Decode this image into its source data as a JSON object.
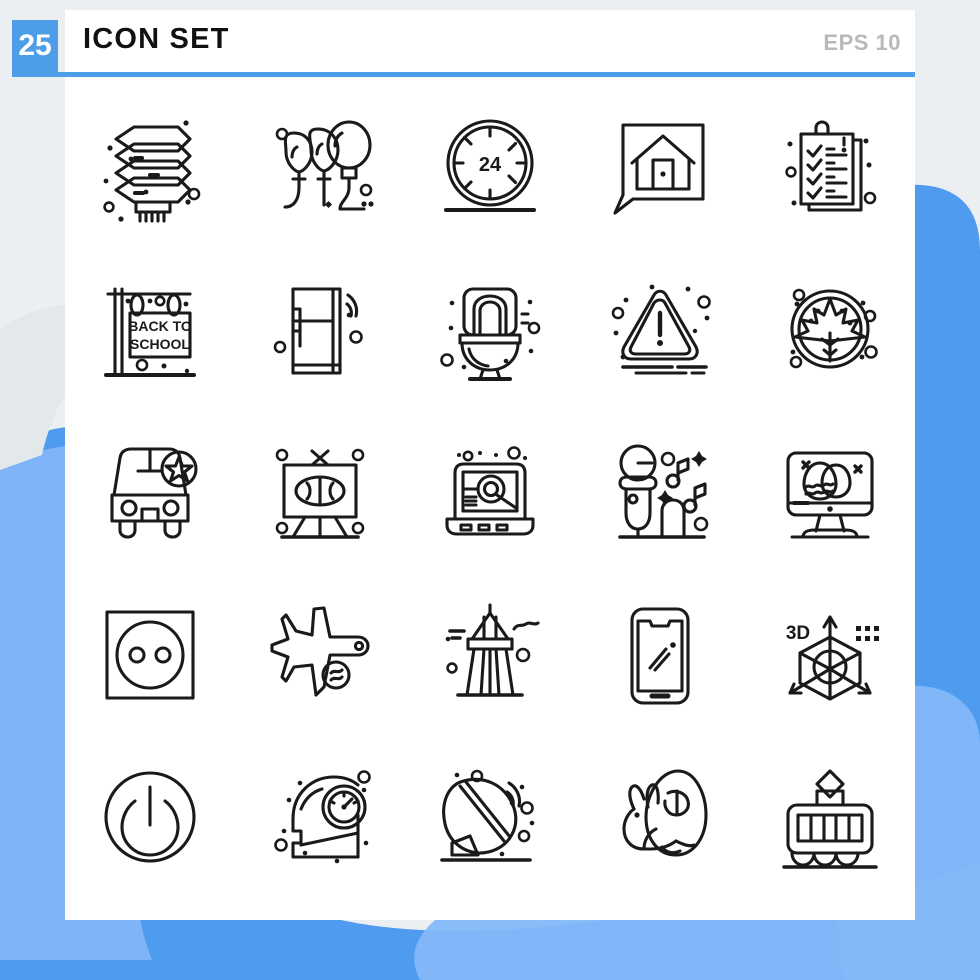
{
  "header": {
    "count_badge": "25",
    "title": "ICON SET",
    "format_label": "EPS 10",
    "accent_color": "#4d9de8",
    "title_color": "#111111",
    "format_color": "#b7b9bb"
  },
  "canvas": {
    "background_color": "#eceff1",
    "card_color": "#ffffff",
    "blob_color_dark": "#4f9bf0",
    "blob_color_light": "#84b8f8",
    "icon_stroke_color": "#1a1a1a"
  },
  "grid": {
    "rows": 5,
    "columns": 5,
    "total": 25
  },
  "icons": [
    {
      "index": 1,
      "name": "server-stack-icon",
      "label": "Server"
    },
    {
      "index": 2,
      "name": "balloons-icon",
      "label": "Balloons"
    },
    {
      "index": 3,
      "name": "clock-24-hours-icon",
      "label": "24 Hours",
      "text": "24"
    },
    {
      "index": 4,
      "name": "home-photo-icon",
      "label": "Home Photo"
    },
    {
      "index": 5,
      "name": "checklist-clipboard-icon",
      "label": "Checklist"
    },
    {
      "index": 6,
      "name": "back-to-school-sign-icon",
      "label": "Back To School",
      "text": [
        "BACK TO",
        "SCHOOL"
      ]
    },
    {
      "index": 7,
      "name": "smart-refrigerator-icon",
      "label": "Smart Fridge"
    },
    {
      "index": 8,
      "name": "toilet-icon",
      "label": "Toilet"
    },
    {
      "index": 9,
      "name": "warning-triangle-icon",
      "label": "Warning"
    },
    {
      "index": 10,
      "name": "maple-leaf-badge-icon",
      "label": "Maple Leaf"
    },
    {
      "index": 11,
      "name": "police-car-icon",
      "label": "Police Car"
    },
    {
      "index": 12,
      "name": "tv-football-icon",
      "label": "Television"
    },
    {
      "index": 13,
      "name": "laptop-email-search-icon",
      "label": "Email Search",
      "text": "@"
    },
    {
      "index": 14,
      "name": "microphone-music-icon",
      "label": "Microphone"
    },
    {
      "index": 15,
      "name": "monitor-easter-eggs-icon",
      "label": "Easter Monitor"
    },
    {
      "index": 16,
      "name": "power-socket-icon",
      "label": "Power Socket"
    },
    {
      "index": 17,
      "name": "airplane-icon",
      "label": "Airplane"
    },
    {
      "index": 18,
      "name": "lighthouse-tower-icon",
      "label": "Lighthouse"
    },
    {
      "index": 19,
      "name": "smartphone-icon",
      "label": "Smartphone"
    },
    {
      "index": 20,
      "name": "cube-3d-axis-icon",
      "label": "3D Cube",
      "text": "3D"
    },
    {
      "index": 21,
      "name": "power-button-icon",
      "label": "Power"
    },
    {
      "index": 22,
      "name": "head-gauge-icon",
      "label": "Mind Performance"
    },
    {
      "index": 23,
      "name": "satellite-dish-icon",
      "label": "Satellite Dish"
    },
    {
      "index": 24,
      "name": "rabbit-egg-icon",
      "label": "Easter Rabbit"
    },
    {
      "index": 25,
      "name": "tram-icon",
      "label": "Tram"
    }
  ]
}
